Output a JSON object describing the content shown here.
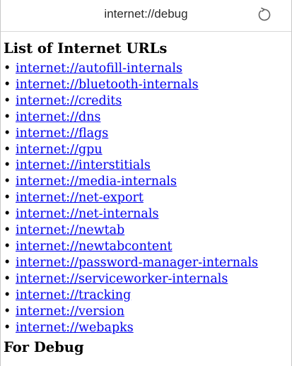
{
  "browser": {
    "url": "internet://debug",
    "reload_icon": "reload-icon"
  },
  "page": {
    "heading": "List of Internet URLs",
    "bullet": "•",
    "links": [
      "internet://autofill-internals",
      "internet://bluetooth-internals",
      "internet://credits",
      "internet://dns",
      "internet://flags",
      "internet://gpu",
      "internet://interstitials",
      "internet://media-internals",
      "internet://net-export",
      "internet://net-internals",
      "internet://newtab",
      "internet://newtabcontent",
      "internet://password-manager-internals",
      "internet://serviceworker-internals",
      "internet://tracking",
      "internet://version",
      "internet://webapks"
    ],
    "section2_heading": "For Debug"
  }
}
